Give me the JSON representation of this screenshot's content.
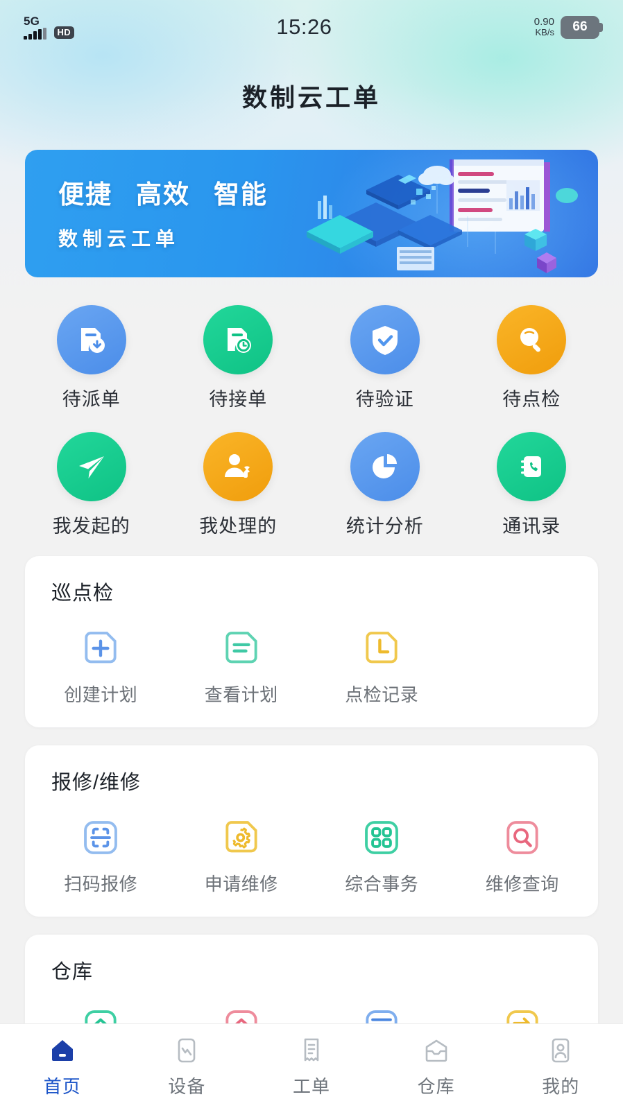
{
  "statusbar": {
    "network_type": "5G",
    "hd_label": "HD",
    "time": "15:26",
    "speed_value": "0.90",
    "speed_unit": "KB/s",
    "battery_level": "66"
  },
  "header": {
    "title": "数制云工单"
  },
  "banner": {
    "keywords": [
      "便捷",
      "高效",
      "智能"
    ],
    "subtitle": "数制云工单",
    "bg_color": "#2f9ff0"
  },
  "quick_actions": [
    {
      "label": "待派单",
      "icon": "document-dispatch-icon",
      "color": "#5A9BEF"
    },
    {
      "label": "待接单",
      "icon": "document-clock-icon",
      "color": "#15CE8E"
    },
    {
      "label": "待验证",
      "icon": "shield-check-icon",
      "color": "#589BEF"
    },
    {
      "label": "待点检",
      "icon": "magnifier-icon",
      "color": "#F5A91A"
    },
    {
      "label": "我发起的",
      "icon": "paper-plane-icon",
      "color": "#14CE92"
    },
    {
      "label": "我处理的",
      "icon": "person-wrench-icon",
      "color": "#F5A91A"
    },
    {
      "label": "统计分析",
      "icon": "pie-chart-icon",
      "color": "#559BF0"
    },
    {
      "label": "通讯录",
      "icon": "contact-book-icon",
      "color": "#11CE92"
    }
  ],
  "sections": [
    {
      "title": "巡点检",
      "items": [
        {
          "label": "创建计划",
          "icon": "document-plus-icon",
          "color": "#8FB8EC"
        },
        {
          "label": "查看计划",
          "icon": "document-lines-icon",
          "color": "#5ED3B2"
        },
        {
          "label": "点检记录",
          "icon": "document-clock-outline-icon",
          "color": "#F2C council"
        }
      ]
    },
    {
      "title": "报修/维修",
      "items": [
        {
          "label": "扫码报修",
          "icon": "scan-code-icon",
          "color": "#8FB8EC"
        },
        {
          "label": "申请维修",
          "icon": "document-gear-icon",
          "color": "#EFC košice"
        },
        {
          "label": "综合事务",
          "icon": "grid-four-icon",
          "color": "#3ECFA3"
        },
        {
          "label": "维修查询",
          "icon": "search-record-icon",
          "color": "#EE8C9C"
        }
      ]
    },
    {
      "title": "仓库",
      "items": [
        {
          "label": "",
          "icon": "warehouse-in-icon",
          "color": "#3ECFA3"
        },
        {
          "label": "",
          "icon": "warehouse-out-icon",
          "color": "#EE8C9C"
        },
        {
          "label": "",
          "icon": "warehouse-query-icon",
          "color": "#7FAEEE"
        },
        {
          "label": "",
          "icon": "warehouse-transfer-icon",
          "color": "#F2C84B"
        }
      ]
    }
  ],
  "tabbar": {
    "active_color": "#1b54c8",
    "items": [
      {
        "label": "首页",
        "icon": "home-icon",
        "active": true
      },
      {
        "label": "设备",
        "icon": "device-icon",
        "active": false
      },
      {
        "label": "工单",
        "icon": "workorder-icon",
        "active": false
      },
      {
        "label": "仓库",
        "icon": "warehouse-icon",
        "active": false
      },
      {
        "label": "我的",
        "icon": "profile-icon",
        "active": false
      }
    ]
  }
}
